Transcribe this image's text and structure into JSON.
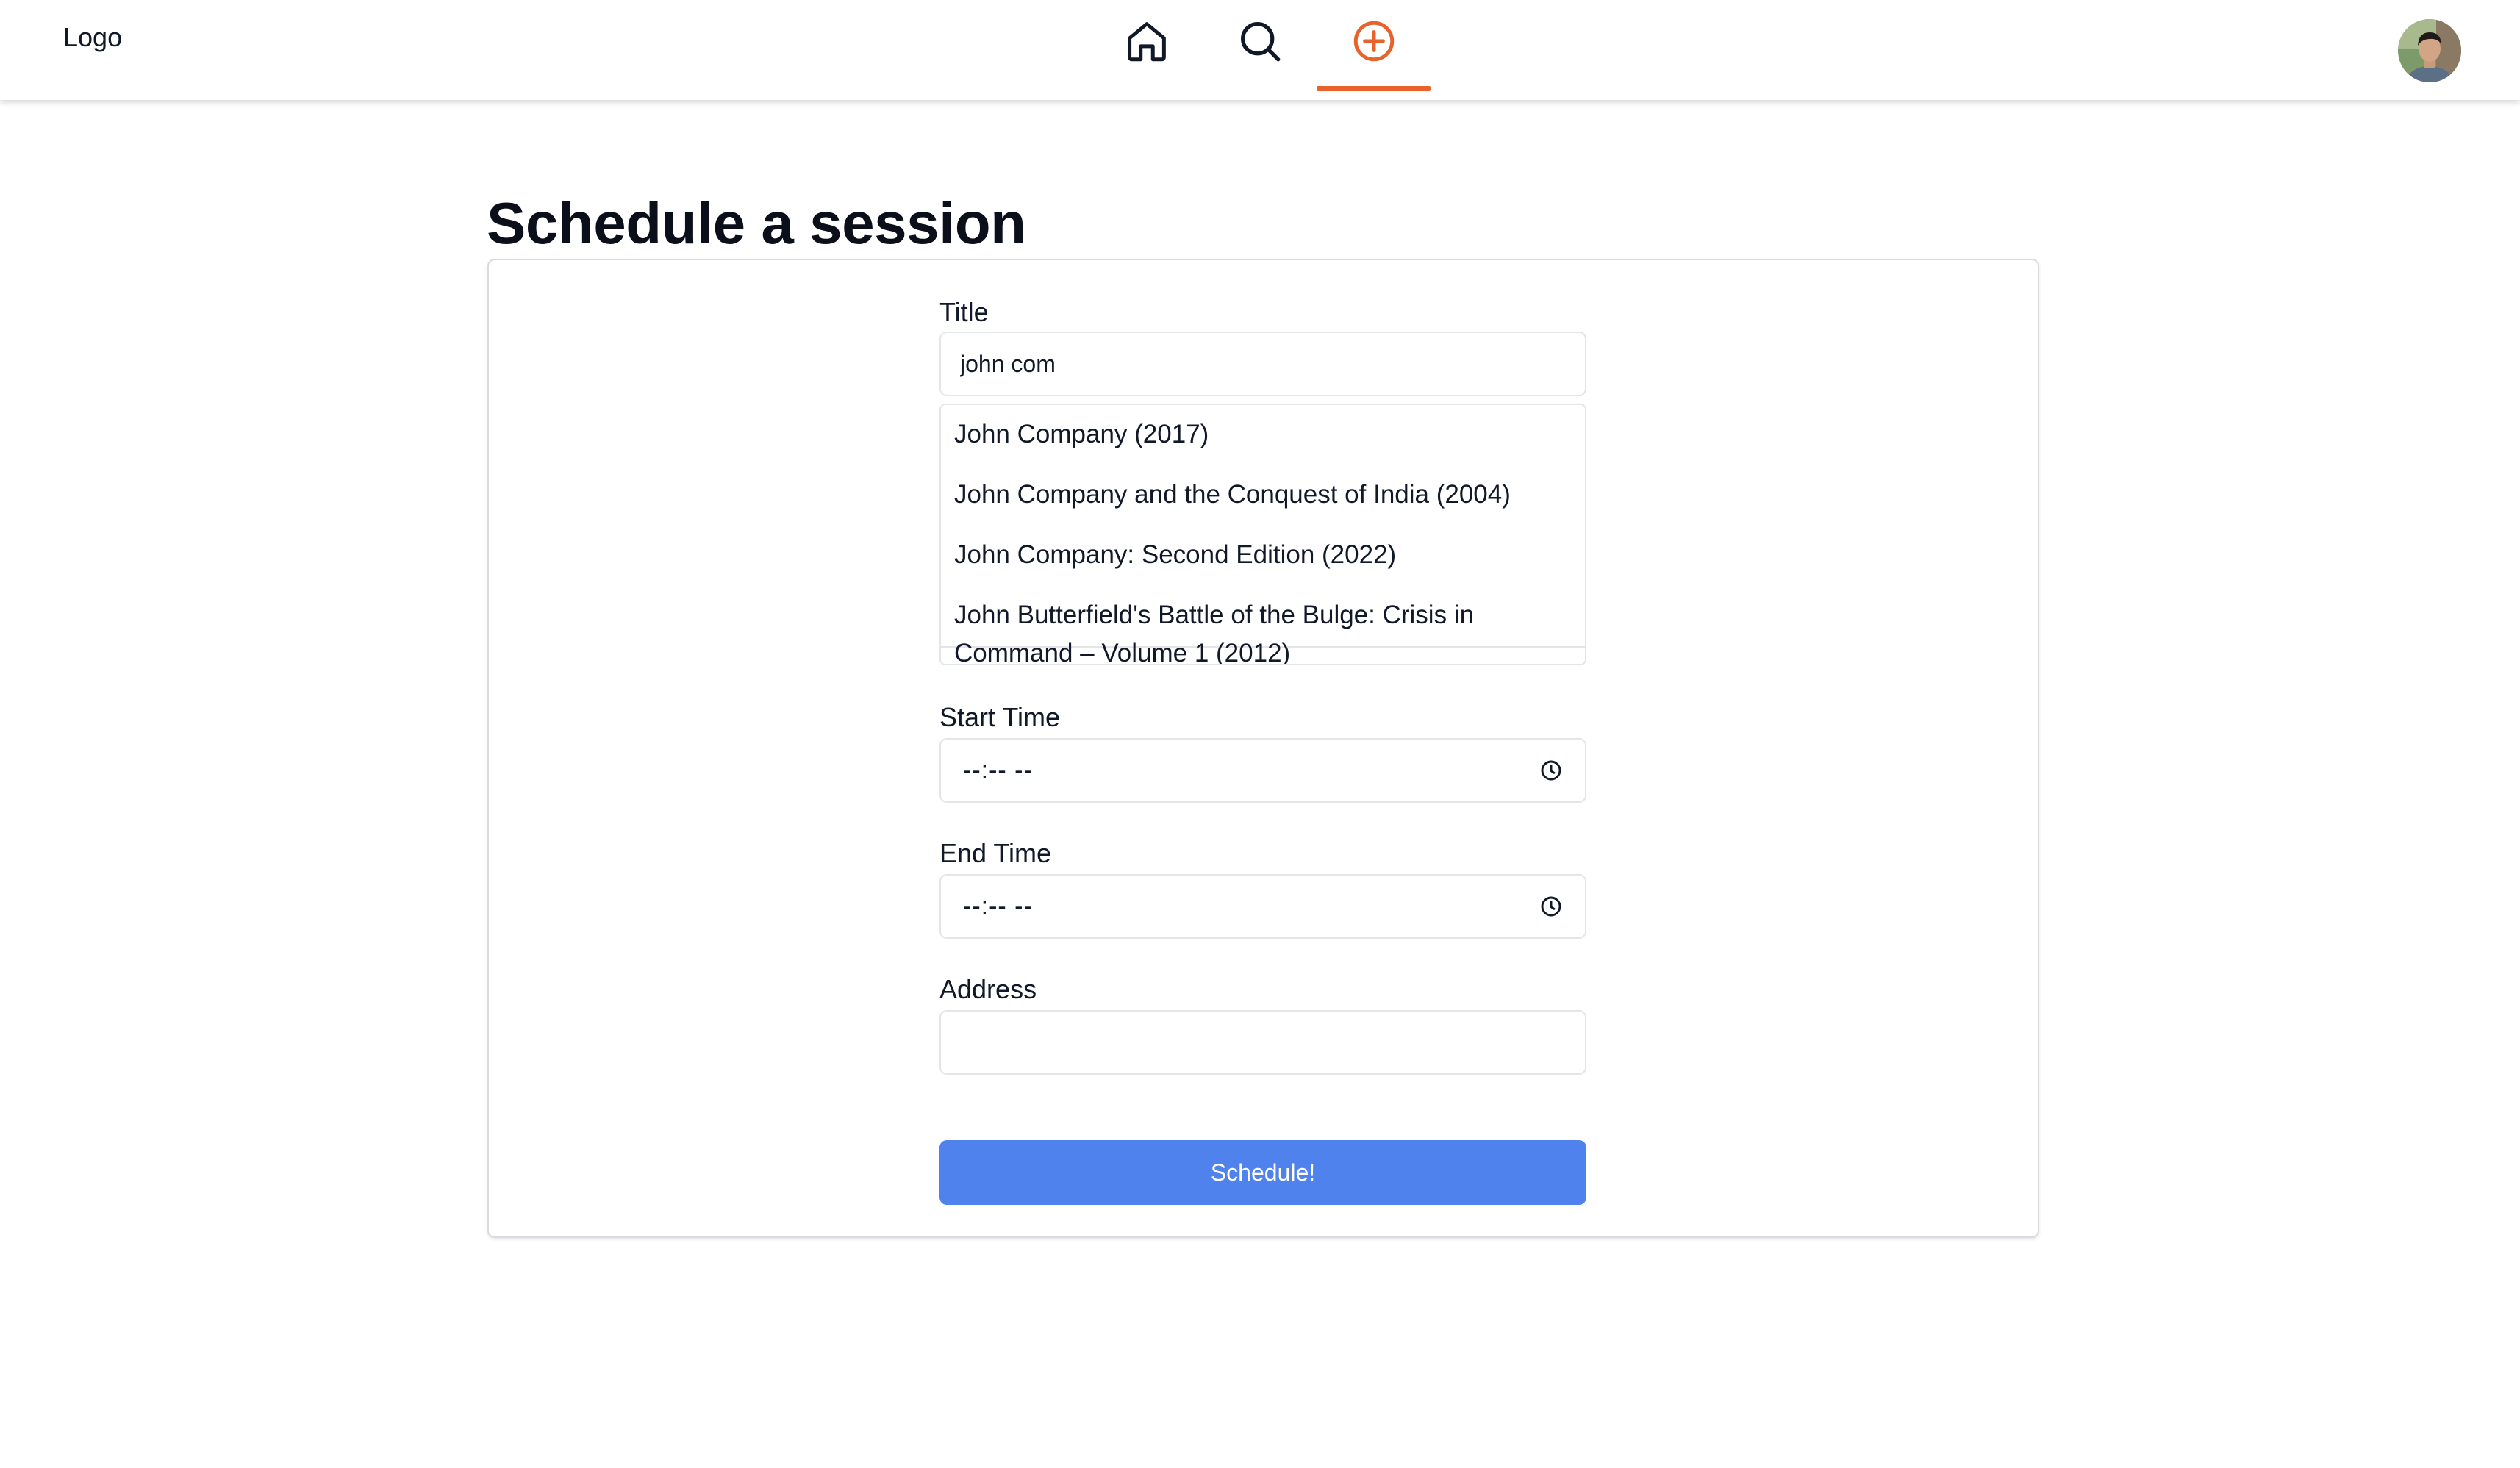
{
  "header": {
    "logo": "Logo",
    "nav": [
      {
        "name": "home",
        "icon": "home-icon",
        "active": false
      },
      {
        "name": "search",
        "icon": "search-icon",
        "active": false
      },
      {
        "name": "add",
        "icon": "plus-circle-icon",
        "active": true
      }
    ],
    "accent_color": "#e8622c"
  },
  "page": {
    "title": "Schedule a session"
  },
  "form": {
    "title_label": "Title",
    "title_value": "john com",
    "suggestions": [
      "John Company (2017)",
      "John Company and the Conquest of India (2004)",
      "John Company: Second Edition (2022)",
      "John Butterfield's Battle of the Bulge: Crisis in Command – Volume 1 (2012)"
    ],
    "start_label": "Start Time",
    "start_value": "--:-- --",
    "end_label": "End Time",
    "end_value": "--:-- --",
    "address_label": "Address",
    "address_value": "",
    "submit_label": "Schedule!",
    "submit_color": "#4f82ed"
  }
}
